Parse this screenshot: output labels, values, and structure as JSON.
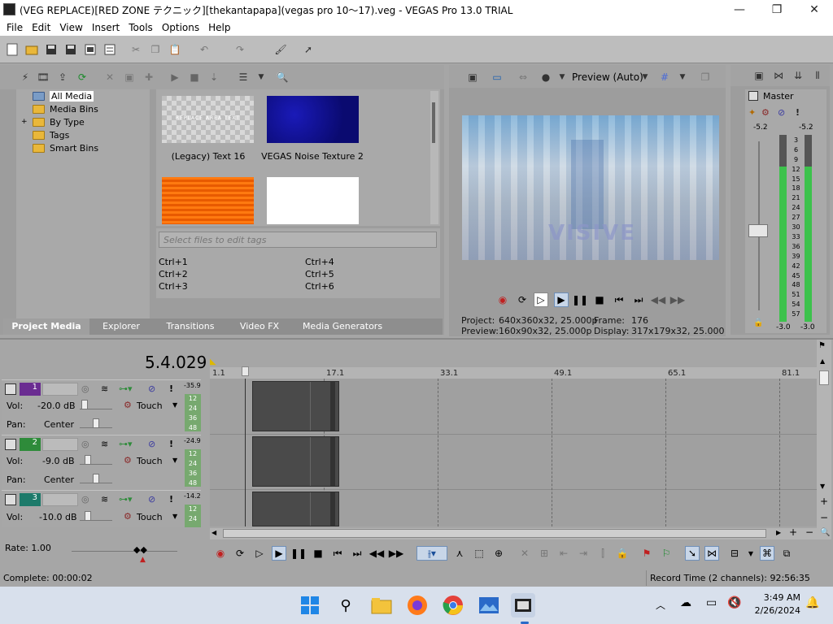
{
  "window": {
    "title": "(VEG REPLACE)[RED ZONE テクニック][thekantapapa](vegas pro 10〜17).veg - VEGAS Pro 13.0 TRIAL",
    "minimize": "—",
    "maximize": "❐",
    "close": "✕"
  },
  "menu": [
    "File",
    "Edit",
    "View",
    "Insert",
    "Tools",
    "Options",
    "Help"
  ],
  "explorer": {
    "tree": [
      {
        "label": "All Media",
        "selected": true
      },
      {
        "label": "Media Bins"
      },
      {
        "label": "By Type",
        "expander": "+"
      },
      {
        "label": "Tags"
      },
      {
        "label": "Smart Bins"
      }
    ],
    "media": [
      {
        "caption": "(Legacy) Text 16",
        "overlay_text": "REPLACE AREA TEXT"
      },
      {
        "caption": "VEGAS Noise Texture 2"
      },
      {
        "caption": ""
      },
      {
        "caption": ""
      }
    ],
    "tags_placeholder": "Select files to edit tags",
    "shortcuts": [
      "Ctrl+1",
      "Ctrl+4",
      "Ctrl+2",
      "Ctrl+5",
      "Ctrl+3",
      "Ctrl+6"
    ],
    "tabs": [
      "Project Media",
      "Explorer",
      "Transitions",
      "Video FX",
      "Media Generators"
    ]
  },
  "preview": {
    "mode": "Preview (Auto)",
    "project_label": "Project:",
    "project_value": "640x360x32, 25.000p",
    "preview_label": "Preview:",
    "preview_value": "160x90x32, 25.000p",
    "frame_label": "Frame:",
    "frame_value": "176",
    "display_label": "Display:",
    "display_value": "317x179x32, 25.000",
    "frame_text": "VISIVE"
  },
  "master": {
    "title": "Master",
    "peak_left": "-5.2",
    "peak_right": "-5.2",
    "scale": [
      "3",
      "6",
      "9",
      "12",
      "15",
      "18",
      "21",
      "24",
      "27",
      "30",
      "33",
      "36",
      "39",
      "42",
      "45",
      "48",
      "51",
      "54",
      "57"
    ],
    "bottom_left": "-3.0",
    "bottom_right": "-3.0",
    "level_fraction": 0.83
  },
  "timeline": {
    "timecode": "5.4.029",
    "ruler": [
      "1.1",
      "17.1",
      "33.1",
      "49.1",
      "65.1",
      "81.1"
    ],
    "tracks": [
      {
        "num": "1",
        "vol_label": "Vol:",
        "vol": "-20.0 dB",
        "pan_label": "Pan:",
        "pan": "Center",
        "mode": "Touch",
        "peak": "-35.9",
        "color": "#6a2c91",
        "meter": [
          "12",
          "24",
          "36",
          "48"
        ]
      },
      {
        "num": "2",
        "vol_label": "Vol:",
        "vol": "-9.0 dB",
        "pan_label": "Pan:",
        "pan": "Center",
        "mode": "Touch",
        "peak": "-24.9",
        "color": "#2e8b3a",
        "meter": [
          "12",
          "24",
          "36",
          "48"
        ]
      },
      {
        "num": "3",
        "vol_label": "Vol:",
        "vol": "-10.0 dB",
        "pan_label": "",
        "pan": "",
        "mode": "Touch",
        "peak": "-14.2",
        "color": "#1d7a6a",
        "meter": [
          "12",
          "24"
        ]
      }
    ],
    "rate": "Rate: 1.00"
  },
  "status": {
    "left": "Complete: 00:00:02",
    "right": "Record Time (2 channels): 92:56:35"
  },
  "taskbar": {
    "time": "3:49 AM",
    "date": "2/26/2024"
  }
}
